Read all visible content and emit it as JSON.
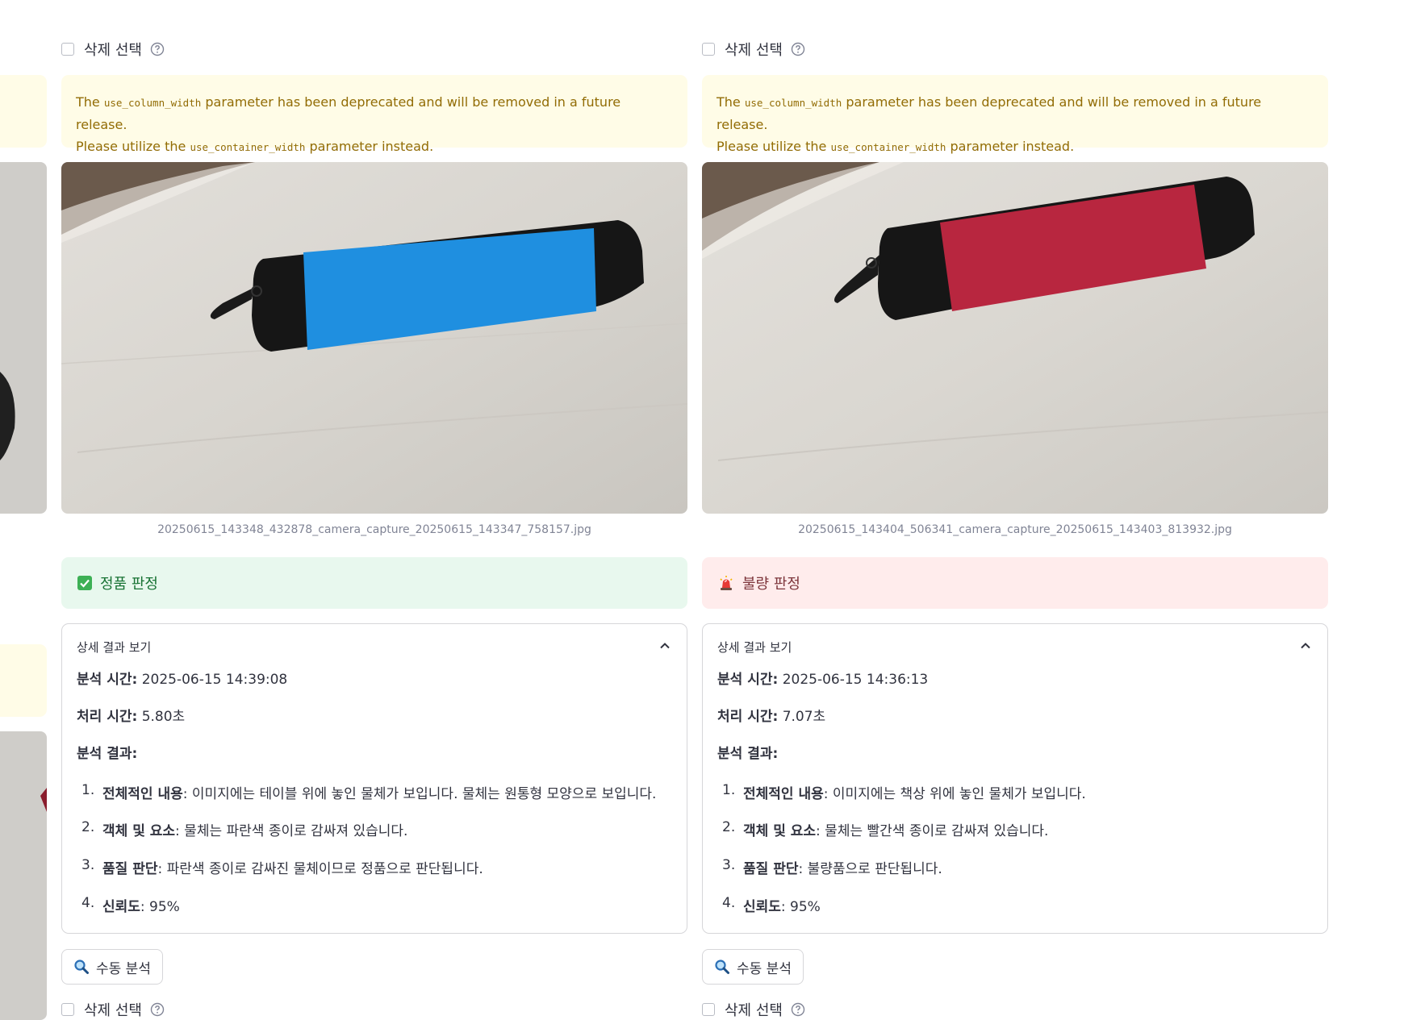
{
  "checkbox_label": "삭제 선택",
  "columns": [
    {
      "warning": {
        "p1": "The ",
        "code1": "use_column_width",
        "p2": " parameter has been deprecated and will be removed in a future release.",
        "p3": "Please utilize the ",
        "code2": "use_container_width",
        "p4": " parameter instead."
      },
      "image_caption": "20250615_143348_432878_camera_capture_20250615_143347_758157.jpg",
      "status_label": "정품 판정",
      "status_icon": "check-box-icon",
      "status_color": "#177233",
      "expander_title": "상세 결과 보기",
      "analysis_time_label": "분석 시간:",
      "analysis_time": "2025-06-15 14:39:08",
      "processing_time_label": "처리 시간:",
      "processing_time": "5.80초",
      "result_label": "분석 결과:",
      "items": [
        {
          "num": "1.",
          "key": "전체적인 내용",
          "text": ": 이미지에는 테이블 위에 놓인 물체가 보입니다. 물체는 원통형 모양으로 보입니다."
        },
        {
          "num": "2.",
          "key": "객체 및 요소",
          "text": ": 물체는 파란색 종이로 감싸져 있습니다."
        },
        {
          "num": "3.",
          "key": "품질 판단",
          "text": ": 파란색 종이로 감싸진 물체이므로 정품으로 판단됩니다."
        },
        {
          "num": "4.",
          "key": "신뢰도",
          "text": ": 95%"
        }
      ],
      "manual_button": "수동 분석",
      "wrap_color": "#1f8fe0"
    },
    {
      "warning": {
        "p1": "The ",
        "code1": "use_column_width",
        "p2": " parameter has been deprecated and will be removed in a future release.",
        "p3": "Please utilize the ",
        "code2": "use_container_width",
        "p4": " parameter instead."
      },
      "image_caption": "20250615_143404_506341_camera_capture_20250615_143403_813932.jpg",
      "status_label": "불량 판정",
      "status_icon": "siren-icon",
      "status_color": "#7d353b",
      "expander_title": "상세 결과 보기",
      "analysis_time_label": "분석 시간:",
      "analysis_time": "2025-06-15 14:36:13",
      "processing_time_label": "처리 시간:",
      "processing_time": "7.07초",
      "result_label": "분석 결과:",
      "items": [
        {
          "num": "1.",
          "key": "전체적인 내용",
          "text": ": 이미지에는 책상 위에 놓인 물체가 보입니다."
        },
        {
          "num": "2.",
          "key": "객체 및 요소",
          "text": ": 물체는 빨간색 종이로 감싸져 있습니다."
        },
        {
          "num": "3.",
          "key": "품질 판단",
          "text": ": 불량품으로 판단됩니다."
        },
        {
          "num": "4.",
          "key": "신뢰도",
          "text": ": 95%"
        }
      ],
      "manual_button": "수동 분석",
      "wrap_color": "#b8263f"
    }
  ]
}
